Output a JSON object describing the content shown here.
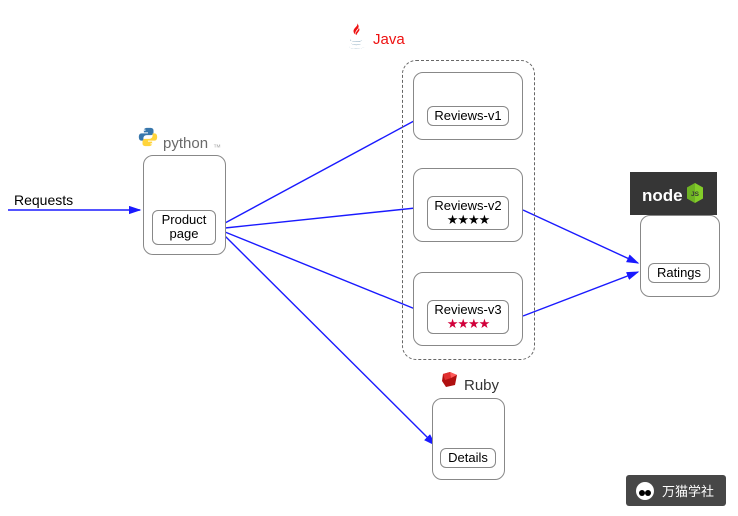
{
  "requests_label": "Requests",
  "tech": {
    "python": "python",
    "java": "Java",
    "ruby": "Ruby",
    "node": "node"
  },
  "nodes": {
    "product_page": "Product\npage",
    "reviews_v1": "Reviews-v1",
    "reviews_v2": "Reviews-v2",
    "reviews_v3": "Reviews-v3",
    "details": "Details",
    "ratings": "Ratings"
  },
  "stars": {
    "v2": "★★★★",
    "v3": "★★★★"
  },
  "watermark": "万猫学社"
}
